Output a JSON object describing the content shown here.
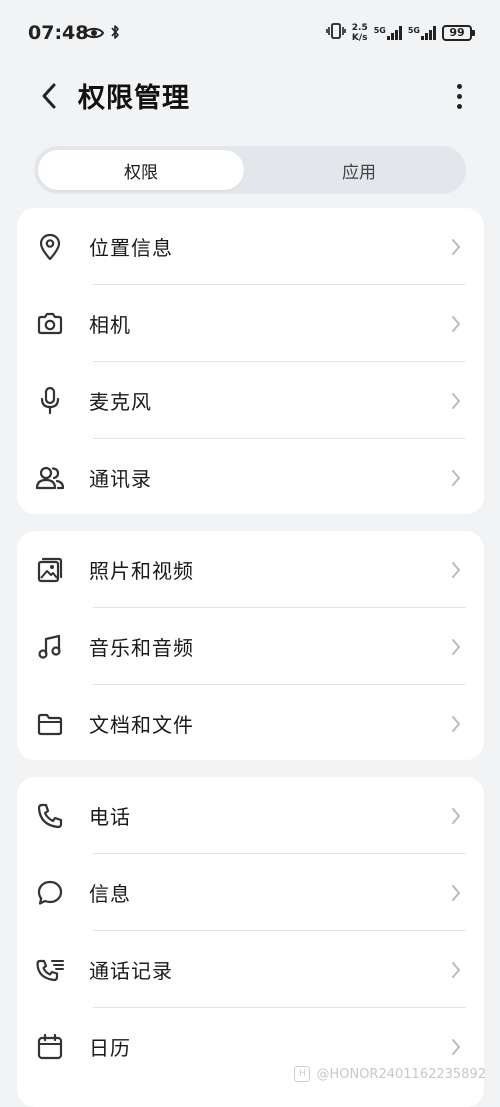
{
  "status_bar": {
    "time": "07:48",
    "speed_top": "2.5",
    "speed_bottom": "K/s",
    "sim1": "5G",
    "sim2": "5G",
    "battery": "99"
  },
  "header": {
    "title": "权限管理"
  },
  "tabs": [
    {
      "label": "权限",
      "active": true
    },
    {
      "label": "应用",
      "active": false
    }
  ],
  "groups": [
    {
      "items": [
        {
          "icon": "location-icon",
          "label": "位置信息"
        },
        {
          "icon": "camera-icon",
          "label": "相机"
        },
        {
          "icon": "microphone-icon",
          "label": "麦克风"
        },
        {
          "icon": "contacts-icon",
          "label": "通讯录"
        }
      ]
    },
    {
      "items": [
        {
          "icon": "photos-icon",
          "label": "照片和视频"
        },
        {
          "icon": "music-icon",
          "label": "音乐和音频"
        },
        {
          "icon": "folder-icon",
          "label": "文档和文件"
        }
      ]
    },
    {
      "items": [
        {
          "icon": "phone-icon",
          "label": "电话"
        },
        {
          "icon": "message-icon",
          "label": "信息"
        },
        {
          "icon": "call-log-icon",
          "label": "通话记录"
        },
        {
          "icon": "calendar-icon",
          "label": "日历"
        }
      ]
    }
  ],
  "watermark": "@HONOR2401162235892"
}
